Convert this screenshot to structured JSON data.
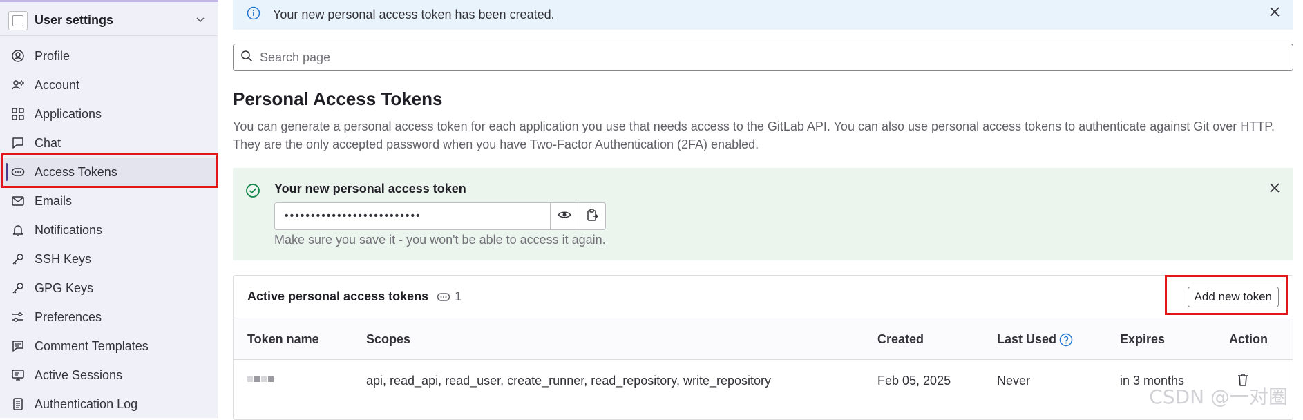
{
  "sidebar": {
    "title": "User settings",
    "items": [
      {
        "label": "Profile",
        "icon": "profile-icon"
      },
      {
        "label": "Account",
        "icon": "account-icon"
      },
      {
        "label": "Applications",
        "icon": "applications-icon"
      },
      {
        "label": "Chat",
        "icon": "chat-icon"
      },
      {
        "label": "Access Tokens",
        "icon": "token-icon",
        "active": true
      },
      {
        "label": "Emails",
        "icon": "mail-icon"
      },
      {
        "label": "Notifications",
        "icon": "bell-icon"
      },
      {
        "label": "SSH Keys",
        "icon": "key-icon"
      },
      {
        "label": "GPG Keys",
        "icon": "key-icon"
      },
      {
        "label": "Preferences",
        "icon": "preferences-icon"
      },
      {
        "label": "Comment Templates",
        "icon": "comment-icon"
      },
      {
        "label": "Active Sessions",
        "icon": "monitor-icon"
      },
      {
        "label": "Authentication Log",
        "icon": "log-icon"
      }
    ]
  },
  "info_alert": {
    "message": "Your new personal access token has been created."
  },
  "search": {
    "placeholder": "Search page"
  },
  "page": {
    "title": "Personal Access Tokens",
    "description": "You can generate a personal access token for each application you use that needs access to the GitLab API. You can also use personal access tokens to authenticate against Git over HTTP. They are the only accepted password when you have Two-Factor Authentication (2FA) enabled."
  },
  "new_token": {
    "title": "Your new personal access token",
    "masked_value": "••••••••••••••••••••••••••",
    "note": "Make sure you save it - you won't be able to access it again."
  },
  "active_tokens": {
    "title": "Active personal access tokens",
    "count": "1",
    "add_button": "Add new token",
    "columns": [
      "Token name",
      "Scopes",
      "Created",
      "Last Used",
      "Expires",
      "Action"
    ],
    "rows": [
      {
        "name": "",
        "scopes": "api, read_api, read_user, create_runner, read_repository, write_repository",
        "created": "Feb 05, 2025",
        "last_used": "Never",
        "expires": "in 3 months"
      }
    ]
  },
  "watermark": "CSDN @一对圈",
  "colors": {
    "highlight": "#e0161b",
    "info_bg": "#e9f3fc",
    "success_bg": "#ecf4ee",
    "help_blue": "#1f75cb",
    "success_green": "#108548"
  }
}
